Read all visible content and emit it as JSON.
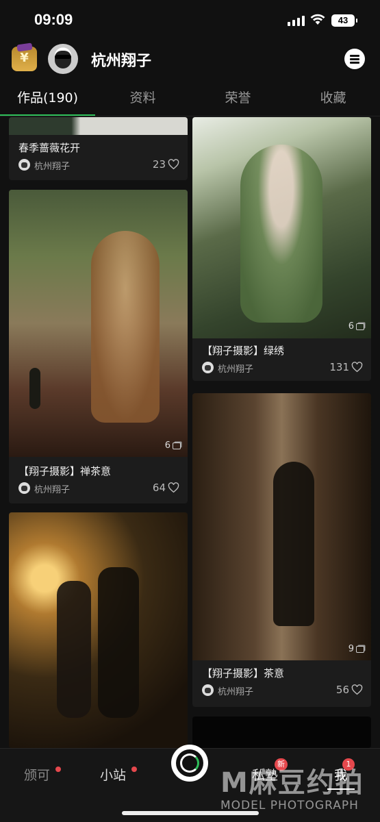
{
  "status_bar": {
    "time": "09:09",
    "battery": "43"
  },
  "header": {
    "username": "杭州翔子"
  },
  "tabs": [
    "作品(190)",
    "资料",
    "荣誉",
    "收藏"
  ],
  "works": [
    {
      "title": "春季蔷薇花开",
      "author": "杭州翔子",
      "likes": "23"
    },
    {
      "title": "【翔子摄影】禅茶意",
      "author": "杭州翔子",
      "likes": "64",
      "images": "6"
    },
    {
      "title": "【翔子摄影】绿绣",
      "author": "杭州翔子",
      "likes": "131",
      "images": "6"
    },
    {
      "title": "【翔子摄影】茶意",
      "author": "杭州翔子",
      "likes": "56",
      "images": "9"
    }
  ],
  "bottom_nav": {
    "item1": "颁可",
    "item2": "小站",
    "item3": "私塾",
    "item3_badge": "新",
    "item4": "我",
    "item4_badge": "1"
  },
  "watermark": {
    "brand": "M麻豆约拍",
    "sub": "MODEL PHOTOGRAPH"
  },
  "colors": {
    "accent": "#2fbf5a",
    "badge": "#e5484d"
  }
}
